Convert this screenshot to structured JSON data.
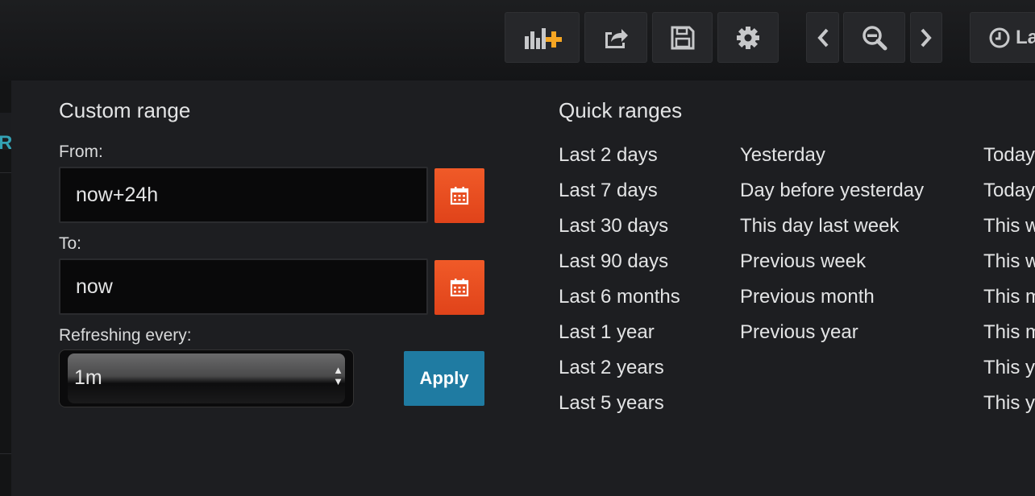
{
  "toolbar": {
    "add_panel_icon": "bar-chart-add-icon",
    "share_icon": "share-icon",
    "save_icon": "save-icon",
    "settings_icon": "gear-icon",
    "prev_icon": "chevron-left-icon",
    "zoom_out_icon": "zoom-out-icon",
    "next_icon": "chevron-right-icon",
    "time_picker_label": "La",
    "accent_color": "#f5a623"
  },
  "left_tab": {
    "label": "Re"
  },
  "custom_range": {
    "title": "Custom range",
    "from_label": "From:",
    "from_value": "now+24h",
    "to_label": "To:",
    "to_value": "now",
    "refresh_label": "Refreshing every:",
    "refresh_value": "1m",
    "apply_label": "Apply",
    "calendar_color": "#e84e1f",
    "apply_color": "#1f7ba2"
  },
  "quick_ranges": {
    "title": "Quick ranges",
    "columns": [
      [
        "Last 2 days",
        "Last 7 days",
        "Last 30 days",
        "Last 90 days",
        "Last 6 months",
        "Last 1 year",
        "Last 2 years",
        "Last 5 years"
      ],
      [
        "Yesterday",
        "Day before yesterday",
        "This day last week",
        "Previous week",
        "Previous month",
        "Previous year"
      ],
      [
        "Today",
        "Today",
        "This w",
        "This w",
        "This m",
        "This m",
        "This y",
        "This y"
      ]
    ]
  }
}
